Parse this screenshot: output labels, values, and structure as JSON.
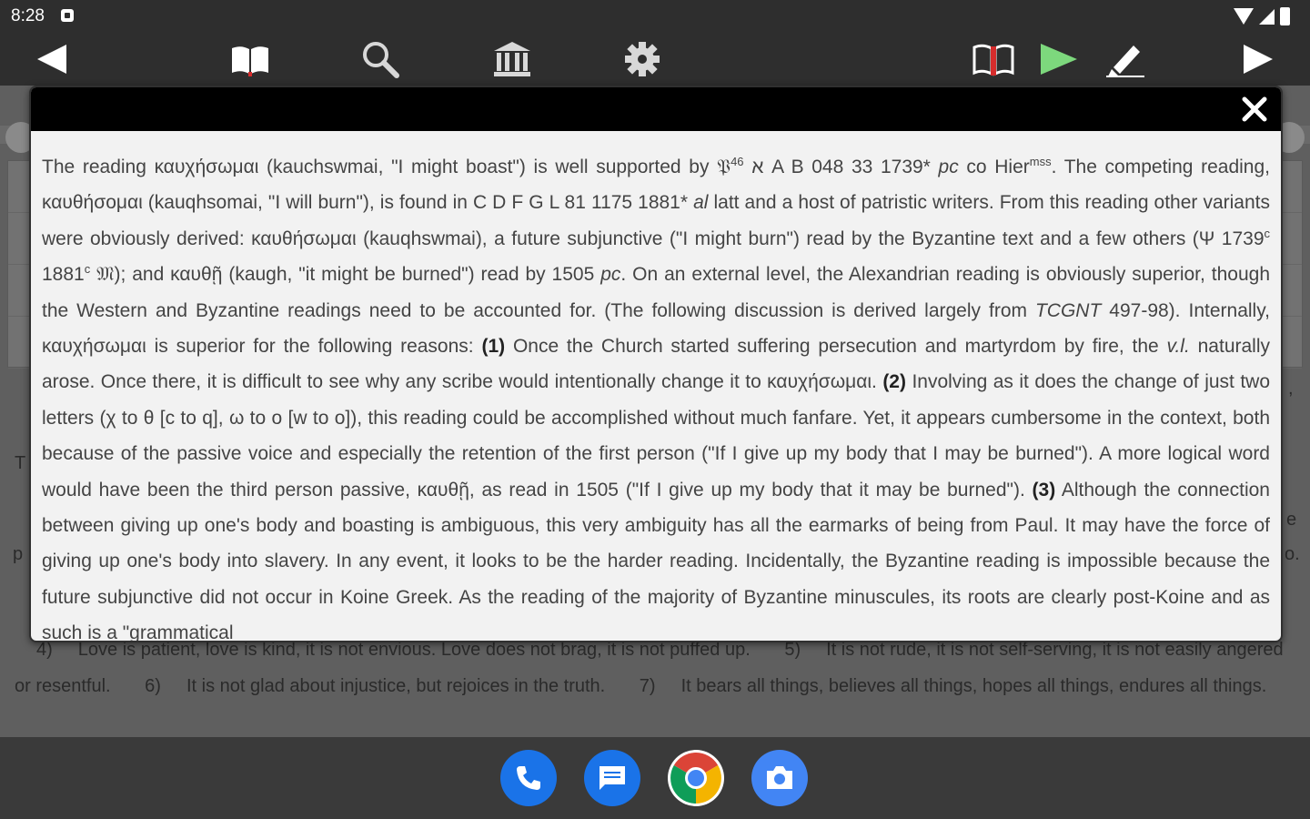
{
  "status": {
    "time": "8:28"
  },
  "toolbar": {
    "back": "back-arrow",
    "books": "book-icon",
    "search": "search-icon",
    "library": "library-icon",
    "settings": "gear-icon",
    "parallel": "parallel-icon",
    "play": "play-icon",
    "edit": "pencil-icon",
    "forward": "forward-arrow"
  },
  "popup": {
    "close_label": "✕",
    "p1": "The reading καυχήσωμαι (kauchswmai, \"I might boast\") is well supported by",
    "p1_ms": "𝔓",
    "p1_sup": "46",
    "p1b": "א A B 048 33 1739*",
    "p1_pc": "pc",
    "p1c": "co Hier",
    "p1_sup2": "mss",
    "p1d": ". The competing reading, καυθήσομαι (kauqhsomai, \"I will burn\"), is found in C D F G L 81 1175 1881*",
    "p1_al": "al",
    "p1e": "latt and a host of patristic writers. From this reading other variants were obviously derived: καυθήσωμαι (kauqhswmai), a future subjunctive (\"I might burn\") read by the Byzantine text and a few others (Ψ 1739",
    "p1_sup3": "c",
    "p1f": " 1881",
    "p1_sup4": "c",
    "p1g": " 𝔐); and καυθῇ (kaugh, \"it might be burned\") read by 1505",
    "p1_pc2": "pc",
    "p1h": ". On an external level, the Alexandrian reading is obviously superior, though the Western and Byzantine readings need to be accounted for. (The following discussion is derived largely from",
    "p1_tcgnt": "TCGNT",
    "p1i": "497-98). Internally, καυχήσωμαι is superior for the following reasons:",
    "n1": "(1)",
    "p1j": "Once the Church started suffering persecution and martyrdom by fire, the",
    "p1_vl": "v.l.",
    "p1k": "naturally arose. Once there, it is difficult to see why any scribe would intentionally change it to καυχήσωμαι.",
    "n2": "(2)",
    "p1l": "Involving as it does the change of just two letters (χ to θ [c to q], ω to ο [w to o]), this reading could be accomplished without much fanfare. Yet, it appears cumbersome in the context, both because of the passive voice and especially the retention of the first person (\"If I give up my body that I may be burned\"). A more logical word would have been the third person passive, καυθῇ, as read in 1505 (\"If I give up my body that it may be burned\").",
    "n3": "(3)",
    "p1m": "Although the connection between giving up one's body and boasting is ambiguous, this very ambiguity has all the earmarks of being from Paul. It may have the force of giving up one's body into slavery. In any event, it looks to be the harder reading. Incidentally, the Byzantine reading is impossible because the future subjunctive did not occur in Koine Greek. As the reading of the majority of Byzantine minuscules, its roots are clearly post-Koine and as such is a \"grammatical"
  },
  "background": {
    "scrap_t": "T",
    "scrap_p": "p",
    "scrap_e": "e",
    "scrap_dot": "o.",
    "scrap_comma": ",",
    "v4_num": "4)",
    "v4_text": "Love is patient, love is kind, it is not envious. Love does not brag, it is not puffed up.",
    "v5_num": "5)",
    "v5_text": "It is not rude, it is not self-serving, it is not easily angered or resentful.",
    "v6_num": "6)",
    "v6_text": "It is not glad about injustice, but rejoices in the truth.",
    "v7_num": "7)",
    "v7_text": "It bears all things, believes all things, hopes all things, endures all things."
  },
  "dock": {
    "phone": "phone-icon",
    "messages": "messages-icon",
    "chrome": "chrome-icon",
    "camera": "camera-icon"
  },
  "colors": {
    "toolbar_bg": "#2e2e2e",
    "popup_header": "#000000",
    "play_green": "#7dd87d",
    "phone_blue": "#1a73e8"
  }
}
